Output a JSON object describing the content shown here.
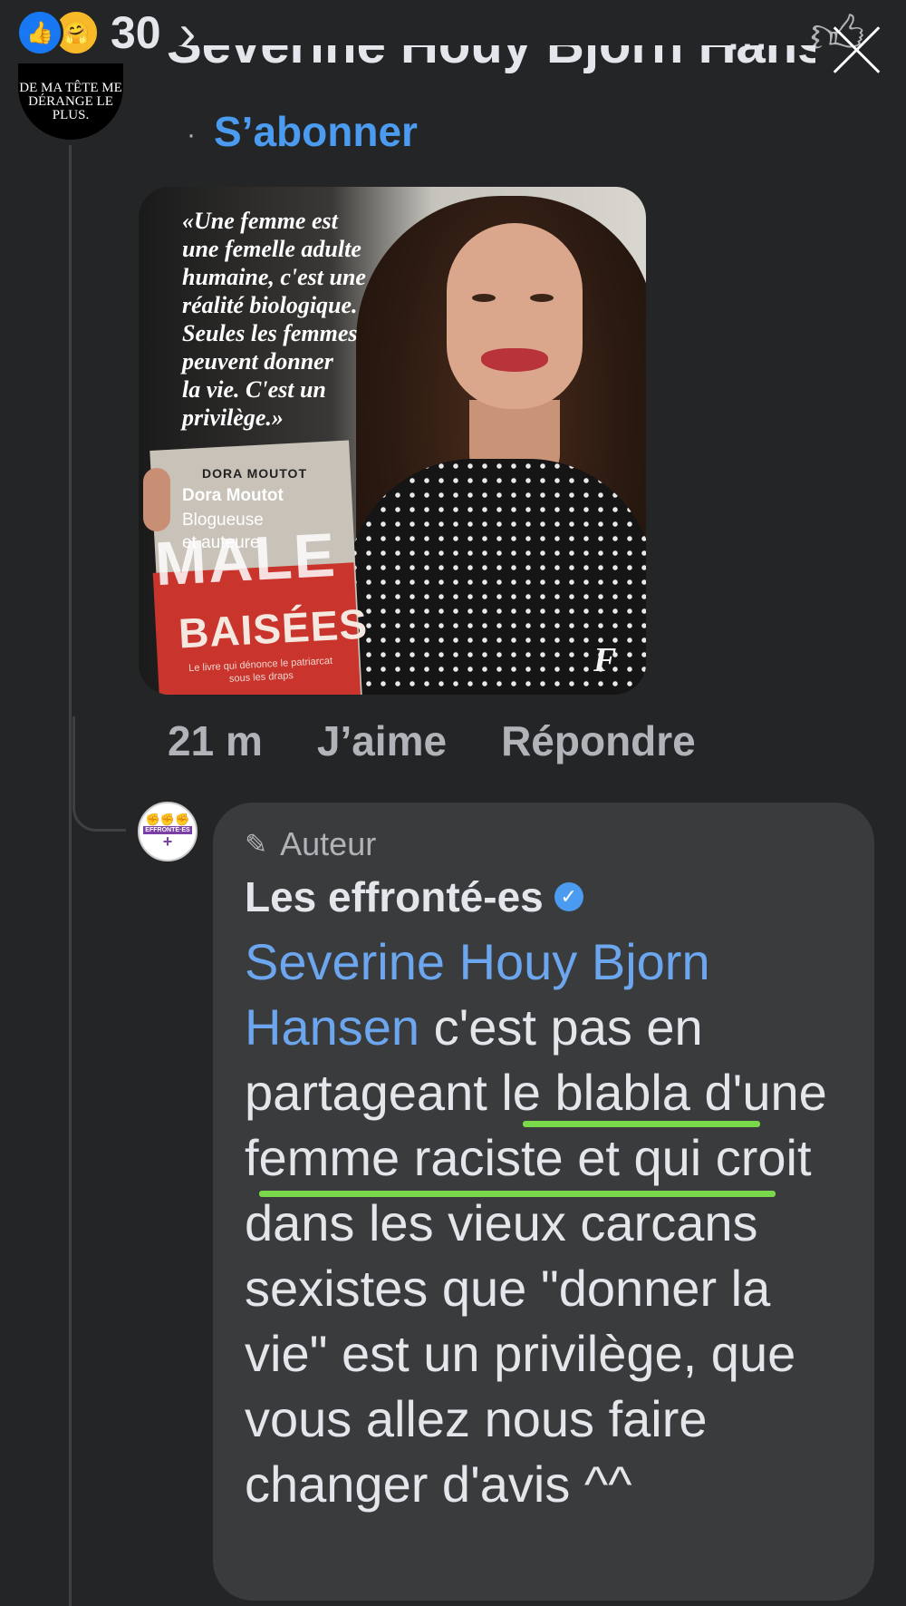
{
  "reactions": {
    "count": "30",
    "icons": [
      "like-icon",
      "care-icon"
    ]
  },
  "first_comment": {
    "author": "Severine Houy Bjorn Hansen",
    "avatar_text": "DE MA TÊTE ME DÉRANGE LE PLUS.",
    "follow_label": "S’abonner",
    "image": {
      "quote": "«Une femme est\nune femelle adulte\nhumaine, c'est une\nréalité biologique.\nSeules les femmes\npeuvent donner\nla vie. C'est un\nprivilège.»",
      "person_name": "Dora Moutot",
      "person_role": "Blogueuse\net auteure",
      "book_author": "DORA MOUTOT",
      "book_title_big": "MALE",
      "book_title": "BAISÉES",
      "book_desc": "Le livre qui dénonce le patriarcat sous les draps",
      "logo": "F"
    },
    "time": "21 m",
    "like_label": "J’aime",
    "reply_label": "Répondre"
  },
  "reply": {
    "badge": "Auteur",
    "author": "Les effronté-es",
    "avatar_text": "EFFRONTÉ·ES",
    "mention": "Severine Houy Bjorn Hansen",
    "text": " c'est pas en partageant le blabla d'une femme raciste et qui croit dans les vieux carcans sexistes que \"donner la vie\" est un privilège, que vous allez nous faire changer d'avis ^^"
  },
  "colors": {
    "background": "#242526",
    "bubble": "#3a3b3c",
    "link": "#4b9bf0",
    "highlight": "#7ad94a"
  }
}
